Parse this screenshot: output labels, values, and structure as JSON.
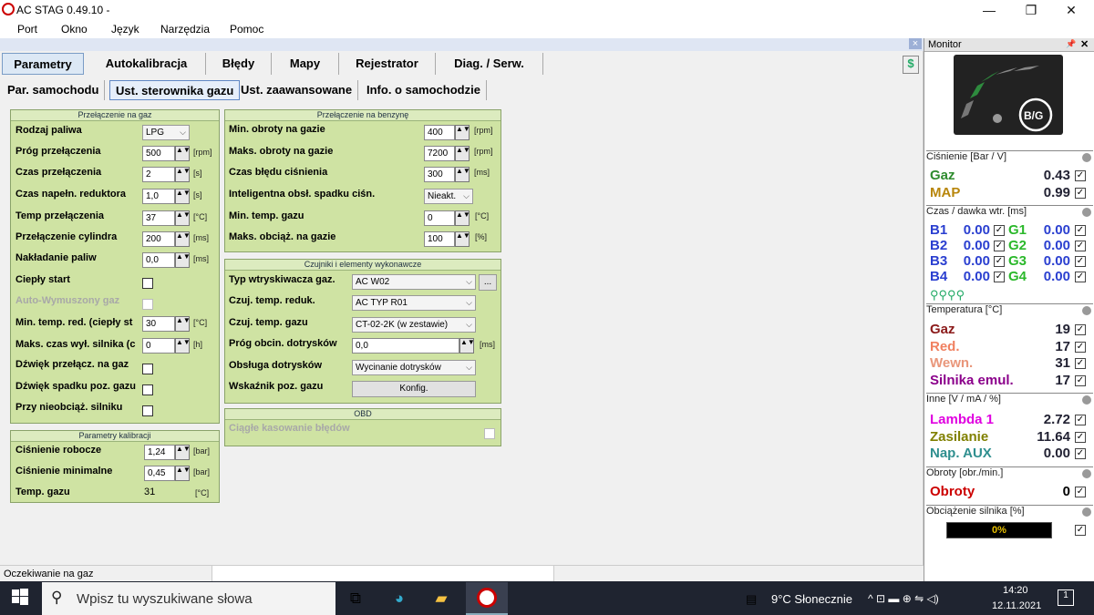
{
  "app": {
    "title": "AC STAG 0.49.10 -",
    "minimize": "—",
    "restore": "❐",
    "close": "✕"
  },
  "menu": [
    "Port",
    "Okno",
    "Język",
    "Narzędzia",
    "Pomoc"
  ],
  "pane": {
    "close": "×",
    "help": "$"
  },
  "tabs": [
    "Parametry",
    "Autokalibracja",
    "Błędy",
    "Mapy",
    "Rejestrator",
    "Diag. / Serw."
  ],
  "subtabs": [
    "Par. samochodu",
    "Ust. sterownika gazu",
    "Ust. zaawansowane",
    "Info. o samochodzie"
  ],
  "spin_glyph": "▲▼",
  "dd_arrow": "⌵",
  "switch_gas": {
    "title": "Przełączenie na gaz",
    "fuel_type": {
      "label": "Rodzaj paliwa",
      "value": "LPG"
    },
    "threshold": {
      "label": "Próg przełączenia",
      "value": "500",
      "unit": "[rpm]"
    },
    "switch_time": {
      "label": "Czas przełączenia",
      "value": "2",
      "unit": "[s]"
    },
    "reducer_fill": {
      "label": "Czas napełn. reduktora",
      "value": "1,0",
      "unit": "[s]"
    },
    "switch_temp": {
      "label": "Temp przełączenia",
      "value": "37",
      "unit": "[°C]"
    },
    "cyl_switch": {
      "label": "Przełączenie cylindra",
      "value": "200",
      "unit": "[ms]"
    },
    "fuel_overlap": {
      "label": "Nakładanie paliw",
      "value": "0,0",
      "unit": "[ms]"
    },
    "warm_start": {
      "label": "Ciepły start"
    },
    "auto_purge": {
      "label": "Auto-Wymuszony gaz"
    },
    "min_red_temp": {
      "label": "Min. temp. red. (ciepły st",
      "value": "30",
      "unit": "[°C]"
    },
    "max_off_time": {
      "label": "Maks. czas wył. silnika (c",
      "value": "0",
      "unit": "[h]"
    },
    "switch_sound": {
      "label": "Dźwięk przełącz. na gaz"
    },
    "low_level_sound": {
      "label": "Dźwięk spadku poz. gazu"
    },
    "no_load": {
      "label": "Przy nieobciąż. silniku"
    }
  },
  "calib": {
    "title": "Parametry kalibracji",
    "work_pressure": {
      "label": "Ciśnienie robocze",
      "value": "1,24",
      "unit": "[bar]"
    },
    "min_pressure": {
      "label": "Ciśnienie minimalne",
      "value": "0,45",
      "unit": "[bar]"
    },
    "gas_temp": {
      "label": "Temp. gazu",
      "value": "31",
      "unit": "[°C]"
    }
  },
  "switch_petrol": {
    "title": "Przełączenie na benzynę",
    "min_rpm": {
      "label": "Min. obroty na gazie",
      "value": "400",
      "unit": "[rpm]"
    },
    "max_rpm": {
      "label": "Maks. obroty na gazie",
      "value": "7200",
      "unit": "[rpm]"
    },
    "pressure_err": {
      "label": "Czas błędu ciśnienia",
      "value": "300",
      "unit": "[ms]"
    },
    "smart_drop": {
      "label": "Inteligentna obsł. spadku ciśn.",
      "value": "Nieakt."
    },
    "min_gas_temp": {
      "label": "Min. temp. gazu",
      "value": "0",
      "unit": "[°C]"
    },
    "max_load": {
      "label": "Maks. obciąż. na gazie",
      "value": "100",
      "unit": "[%]"
    }
  },
  "sensors": {
    "title": "Czujniki i elementy wykonawcze",
    "injector": {
      "label": "Typ wtryskiwacza gaz.",
      "value": "AC W02",
      "more": "..."
    },
    "red_sensor": {
      "label": "Czuj. temp. reduk.",
      "value": "AC TYP R01"
    },
    "gas_sensor": {
      "label": "Czuj. temp. gazu",
      "value": "CT-02-2K (w zestawie)"
    },
    "boost_threshold": {
      "label": "Próg obcin. dotrysków",
      "value": "0,0",
      "unit": "[ms]"
    },
    "boost_handling": {
      "label": "Obsługa dotrysków",
      "value": "Wycinanie dotrysków"
    },
    "level_indicator": {
      "label": "Wskaźnik poz. gazu",
      "button": "Konfig."
    }
  },
  "obd": {
    "title": "OBD",
    "clear_errors": "Ciągłe kasowanie błędów"
  },
  "status": "Oczekiwanie na gaz",
  "monitor": {
    "title": "Monitor",
    "pin": "📌",
    "close": "✕",
    "bg_label": "B/G",
    "pressure_header": "Ciśnienie [Bar / V]",
    "pressure": [
      {
        "name": "Gaz",
        "value": "0.43",
        "color": "#2e8b2e"
      },
      {
        "name": "MAP",
        "value": "0.99",
        "color": "#b8860b"
      }
    ],
    "inj_header": "Czas / dawka wtr. [ms]",
    "inj_b": [
      {
        "name": "B1",
        "value": "0.00"
      },
      {
        "name": "B2",
        "value": "0.00"
      },
      {
        "name": "B3",
        "value": "0.00"
      },
      {
        "name": "B4",
        "value": "0.00"
      }
    ],
    "inj_g": [
      {
        "name": "G1",
        "value": "0.00"
      },
      {
        "name": "G2",
        "value": "0.00"
      },
      {
        "name": "G3",
        "value": "0.00"
      },
      {
        "name": "G4",
        "value": "0.00"
      }
    ],
    "check": "✓",
    "temp_header": "Temperatura [°C]",
    "temps": [
      {
        "name": "Gaz",
        "value": "19",
        "color": "#8b1a1a"
      },
      {
        "name": "Red.",
        "value": "17",
        "color": "#f08060"
      },
      {
        "name": "Wewn.",
        "value": "31",
        "color": "#e9967a"
      },
      {
        "name": "Silnika emul.",
        "value": "17",
        "color": "#8b008b"
      }
    ],
    "other_header": "Inne [V / mA / %]",
    "others": [
      {
        "name": "Lambda 1",
        "value": "2.72",
        "color": "#e000e0"
      },
      {
        "name": "Zasilanie",
        "value": "11.64",
        "color": "#808000"
      },
      {
        "name": "Nap. AUX",
        "value": "0.00",
        "color": "#2f8f8f"
      }
    ],
    "rpm_header": "Obroty [obr./min.]",
    "rpm": {
      "name": "Obroty",
      "value": "0",
      "color": "#cc0000"
    },
    "load_header": "Obciążenie silnika [%]",
    "load": {
      "value": "0%",
      "fraction": 0
    }
  },
  "taskbar": {
    "search": "Wpisz tu wyszukiwane słowa",
    "weather": "9°C  Słonecznie",
    "time": "14:20",
    "date": "12.11.2021",
    "notif": "1",
    "tray": "^  ⊡  ▬  ⊕  ⇋  ◁)"
  }
}
